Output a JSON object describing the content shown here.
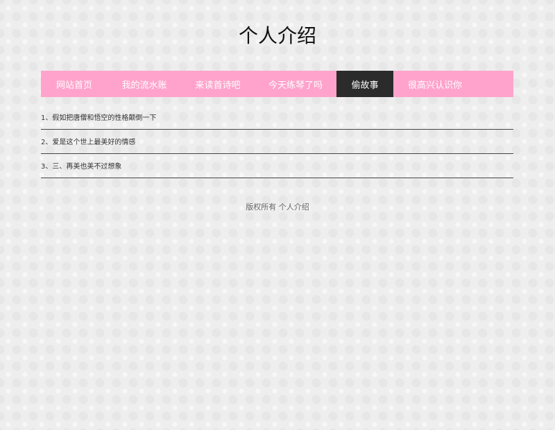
{
  "page": {
    "title": "个人介绍"
  },
  "nav": {
    "items": [
      {
        "label": "网站首页"
      },
      {
        "label": "我的流水账"
      },
      {
        "label": "来读首诗吧"
      },
      {
        "label": "今天练琴了吗"
      },
      {
        "label": "偷故事"
      },
      {
        "label": "很高兴认识你"
      }
    ],
    "active_index": 4
  },
  "articles": [
    {
      "text": "1、假如把唐僧和悟空的性格颠倒一下"
    },
    {
      "text": "2、爱是这个世上最美好的情感"
    },
    {
      "text": "3、三、再美也美不过想象"
    }
  ],
  "footer": {
    "copyright": "版权所有 个人介绍"
  },
  "colors": {
    "nav_background": "#ffa3cc",
    "nav_active": "#2b2b2b",
    "page_background": "#eeeeee"
  }
}
